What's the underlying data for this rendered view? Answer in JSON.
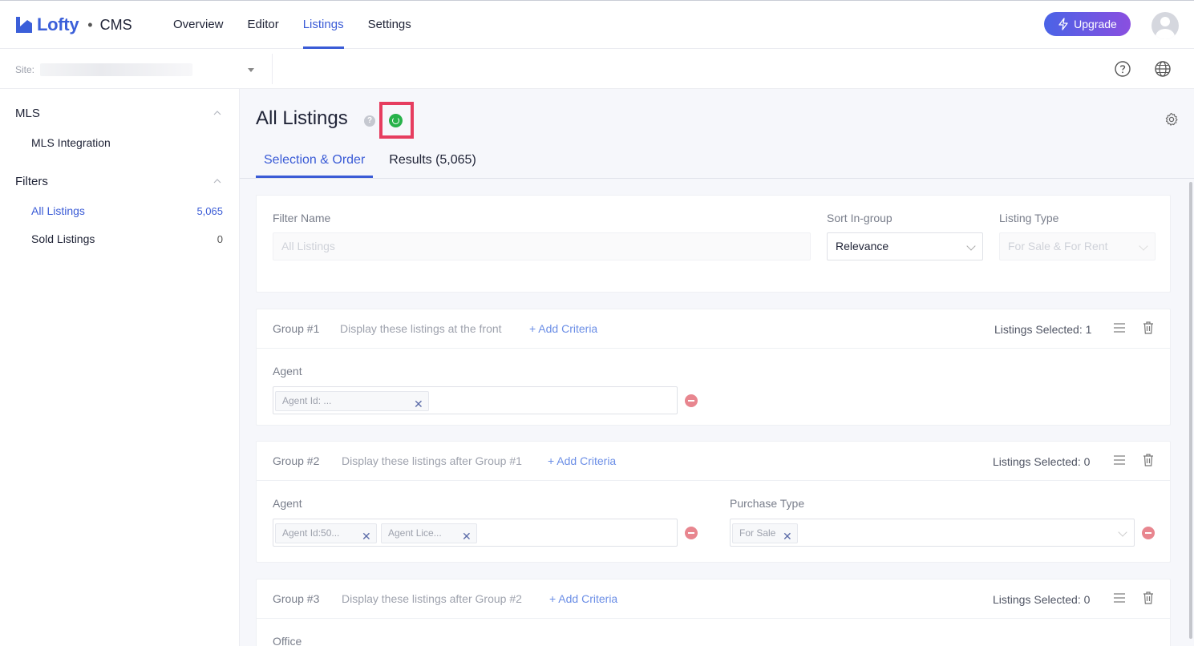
{
  "app": {
    "brand": "Lofty",
    "separator": "•",
    "product": "CMS",
    "brand_color": "#3b5fd9",
    "accent_color": "#3a5bd6"
  },
  "nav": {
    "items": [
      {
        "label": "Overview",
        "active": false
      },
      {
        "label": "Editor",
        "active": false
      },
      {
        "label": "Listings",
        "active": true
      },
      {
        "label": "Settings",
        "active": false
      }
    ],
    "upgrade_label": "Upgrade",
    "upgrade_icon": "lightning-icon",
    "avatar_icon": "user-avatar"
  },
  "sitebar": {
    "site_label": "Site:",
    "help_icon": "question-circle-icon",
    "language_icon": "globe-icon"
  },
  "sidebar": {
    "sections": [
      {
        "title": "MLS",
        "items": [
          {
            "label": "MLS Integration",
            "count": ""
          }
        ]
      },
      {
        "title": "Filters",
        "items": [
          {
            "label": "All Listings",
            "count": "5,065",
            "active": true
          },
          {
            "label": "Sold Listings",
            "count": "0",
            "active": false
          }
        ]
      }
    ]
  },
  "page": {
    "title": "All Listings",
    "help_glyph": "?",
    "status_icon": "sync-status-icon",
    "status_color": "#27b24a",
    "highlight_color": "#e63d5f",
    "settings_icon": "gear-icon",
    "tabs": [
      {
        "label": "Selection & Order",
        "active": true
      },
      {
        "label": "Results (5,065)",
        "active": false
      }
    ]
  },
  "filter": {
    "name_label": "Filter Name",
    "name_value": "All Listings",
    "sort_label": "Sort In-group",
    "sort_value": "Relevance",
    "type_label": "Listing Type",
    "type_value": "For Sale & For Rent"
  },
  "groups": [
    {
      "title": "Group #1",
      "description": "Display these listings at the front",
      "add_label": "+ Add Criteria",
      "selected": "Listings Selected: 1",
      "criteria": [
        {
          "label": "Agent",
          "tags": [
            "Agent Id:                    ..."
          ]
        }
      ]
    },
    {
      "title": "Group #2",
      "description": "Display these listings after Group #1",
      "add_label": "+ Add Criteria",
      "selected": "Listings Selected: 0",
      "criteria": [
        {
          "label": "Agent",
          "tags": [
            "Agent Id:50...",
            "Agent Lice..."
          ]
        },
        {
          "label": "Purchase Type",
          "tags": [
            "For Sale"
          ]
        }
      ]
    },
    {
      "title": "Group #3",
      "description": "Display these listings after Group #2",
      "add_label": "+ Add Criteria",
      "selected": "Listings Selected: 0",
      "criteria": [
        {
          "label": "Office",
          "tags": []
        }
      ]
    }
  ],
  "tag_remove_glyph": "✕"
}
